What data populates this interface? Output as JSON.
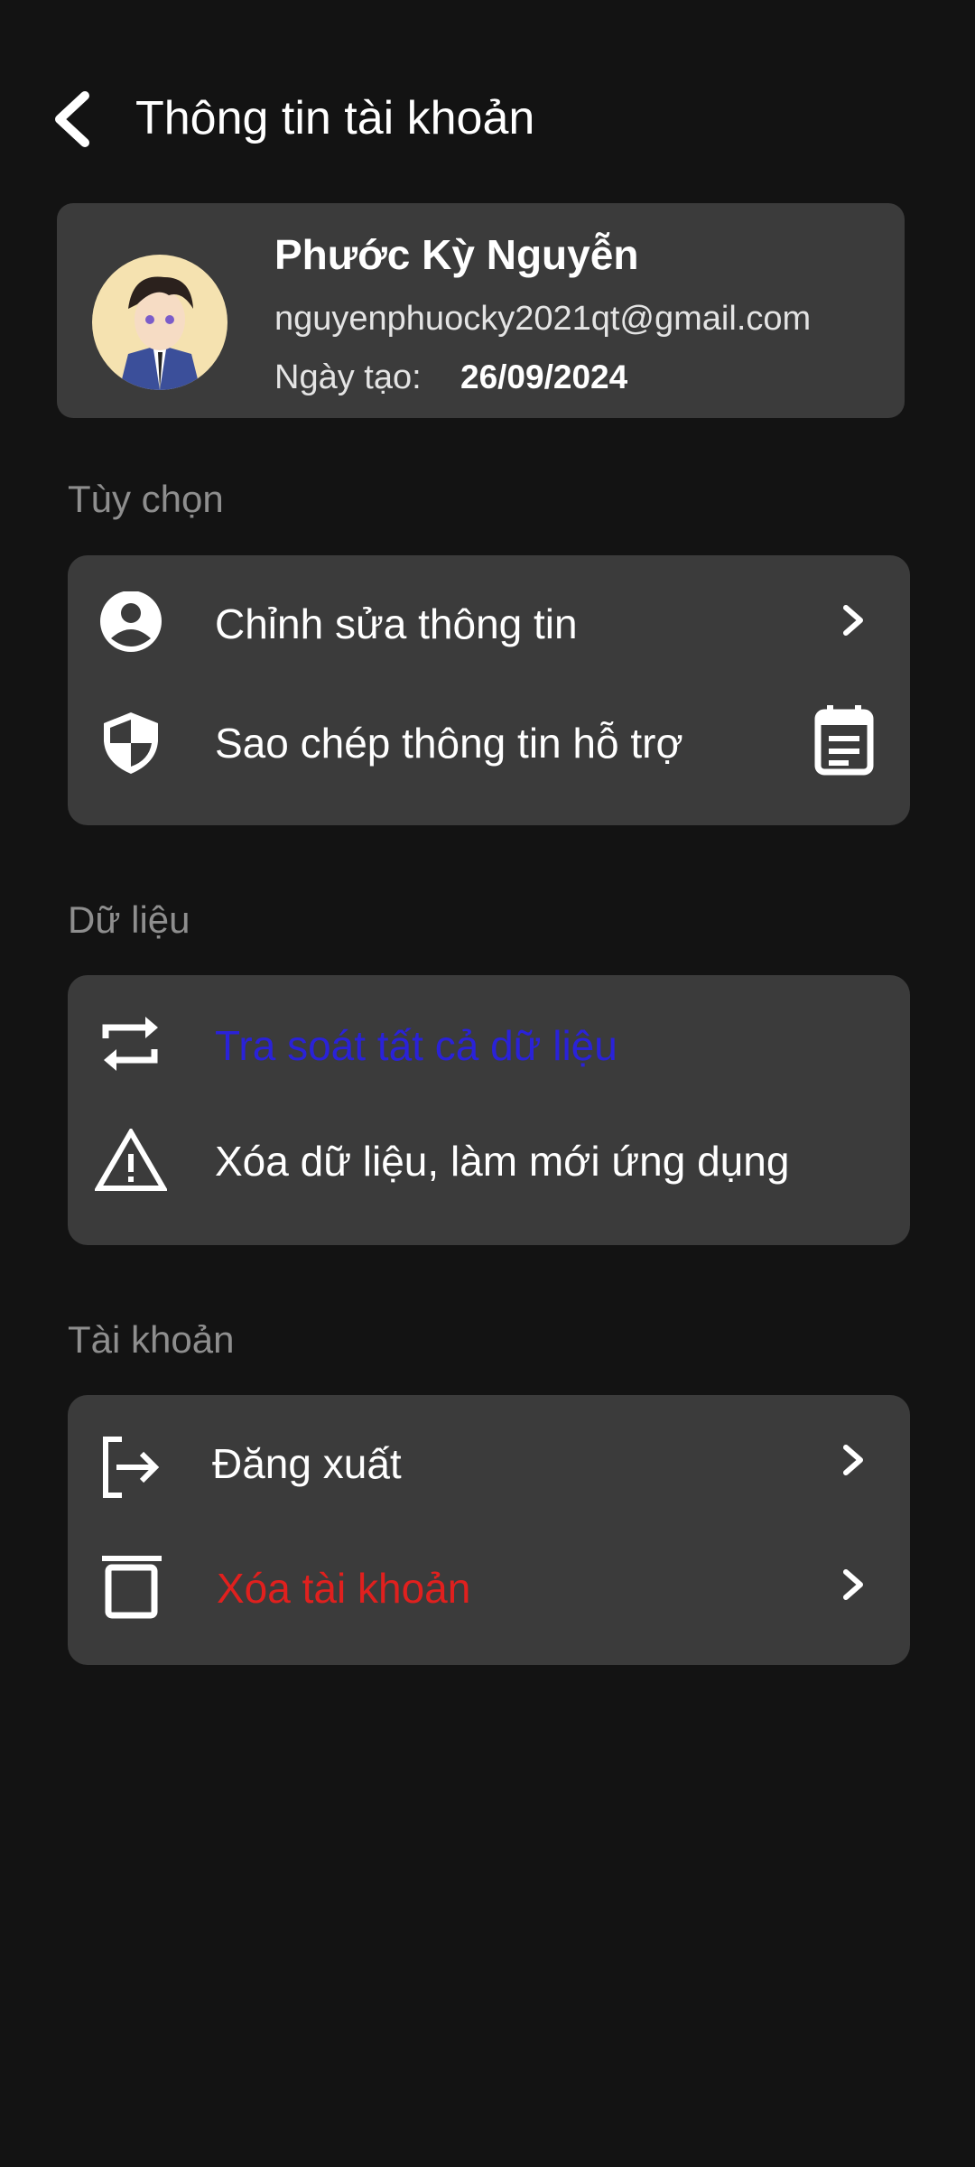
{
  "header": {
    "title": "Thông tin tài khoản",
    "back_icon": "chevron-left-icon"
  },
  "profile": {
    "name": "Phước Kỳ Nguyễn",
    "email": "nguyenphuocky2021qt@gmail.com",
    "created_label": "Ngày tạo:",
    "created_date": "26/09/2024"
  },
  "sections": {
    "options": {
      "title": "Tùy chọn",
      "items": [
        {
          "label": "Chỉnh sửa thông tin",
          "icon": "account-circle-icon",
          "tail": "chevron-right-icon"
        },
        {
          "label": "Sao chép thông tin hỗ trợ",
          "icon": "shield-icon",
          "tail": "clipboard-icon"
        }
      ]
    },
    "data": {
      "title": "Dữ liệu",
      "items": [
        {
          "label": "Tra soát tất cả dữ liệu",
          "icon": "sync-arrows-icon",
          "color": "#2a22d8"
        },
        {
          "label": "Xóa dữ liệu, làm mới ứng dụng",
          "icon": "warning-icon"
        }
      ]
    },
    "account": {
      "title": "Tài khoản",
      "items": [
        {
          "label": "Đăng xuất",
          "icon": "logout-icon",
          "tail": "chevron-right-icon"
        },
        {
          "label": "Xóa tài khoản",
          "icon": "trash-icon",
          "tail": "chevron-right-icon",
          "color": "#e0201e"
        }
      ]
    }
  },
  "colors": {
    "background": "#131313",
    "card": "#3b3b3b",
    "section": "#8e8e8e"
  }
}
